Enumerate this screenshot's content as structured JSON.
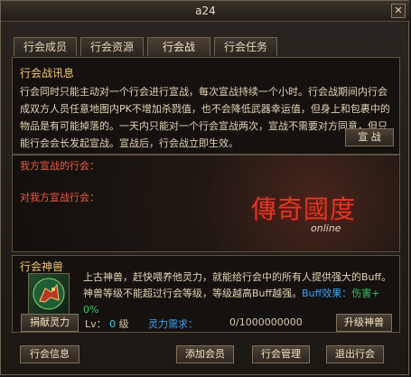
{
  "window": {
    "title": "a24",
    "close_icon": "close-icon"
  },
  "tabs": [
    "行会成员",
    "行会资源",
    "行会战",
    "行会任务"
  ],
  "active_tab_index": 2,
  "war_info": {
    "title": "行会战讯息",
    "text": "行会同时只能主动对一个行会进行宣战，每次宣战持续一个小时。行会战期间内行会成双方人员任意地图内PK不增加杀戮值，也不会降低武器幸运值，但身上和包裹中的物品是有可能掉落的。一天内只能对一个行会宣战两次，宣战不需要对方同意，但只能行会会长发起宣战。宣战后，行会战立即生效。",
    "declare_button": "宣 战"
  },
  "war_status": {
    "our_declared_label": "我方宣战的行会：",
    "declared_us_label": "对我方宣战行会："
  },
  "logo": {
    "main_text": "傳奇國度",
    "sub_text": "online"
  },
  "beast": {
    "title": "行会神兽",
    "icon": "beast-icon",
    "description_line1": "上古神兽，赶快喂养他灵力，就能给行会中的所有人提供强大的Buff。",
    "description_line2_prefix": "神兽等级不能超过行会等级，等级越高Buff越强。",
    "buff_label": "Buff效果：",
    "buff_value": "伤害+ 0%",
    "donate_button": "捐献灵力",
    "level_label": "Lv：",
    "level_value": "0",
    "level_unit": "级",
    "spirit_label": "灵力需求：",
    "spirit_value": "0/1000000000",
    "upgrade_button": "升级神兽"
  },
  "footer": {
    "info_button": "行会信息",
    "add_member_button": "添加会员",
    "manage_button": "行会管理",
    "leave_button": "退出行会"
  }
}
